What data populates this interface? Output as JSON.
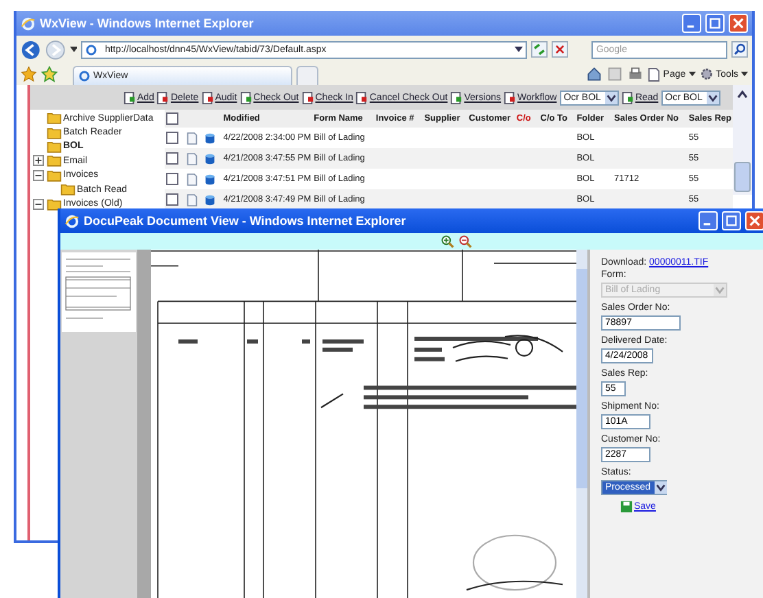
{
  "browser": {
    "title": "WxView - Windows Internet Explorer",
    "address": "http://localhost/dnn45/WxView/tabid/73/Default.aspx",
    "search": {
      "placeholder": "Google"
    },
    "tabs": [
      {
        "label": "WxView",
        "selected": true
      }
    ],
    "commands": [
      "Page",
      "Tools"
    ]
  },
  "toolbar": [
    {
      "kind": "link",
      "label": "Add"
    },
    {
      "kind": "link",
      "label": "Delete"
    },
    {
      "kind": "link",
      "label": "Audit"
    },
    {
      "kind": "link",
      "label": "Check Out"
    },
    {
      "kind": "link",
      "label": "Check In"
    },
    {
      "kind": "link",
      "label": "Cancel Check Out"
    },
    {
      "kind": "link",
      "label": "Versions"
    },
    {
      "kind": "link",
      "label": "Workflow"
    },
    {
      "kind": "select",
      "value": "Ocr BOL"
    },
    {
      "kind": "link",
      "label": "Read"
    },
    {
      "kind": "select",
      "value": "Ocr BOL"
    }
  ],
  "folder_tree": [
    {
      "label": "Archive SupplierData",
      "kind": "leaf",
      "selected": false
    },
    {
      "label": "Batch Reader",
      "kind": "leaf",
      "selected": false
    },
    {
      "label": "BOL",
      "kind": "leaf",
      "selected": true
    },
    {
      "label": "Email",
      "kind": "branch",
      "expanded": false,
      "selected": false
    },
    {
      "label": "Invoices",
      "kind": "branch",
      "expanded": true,
      "selected": false,
      "children": [
        {
          "label": "Batch Read",
          "kind": "leaf",
          "selected": false
        }
      ]
    },
    {
      "label": "Invoices (Old)",
      "kind": "branch",
      "expanded": true,
      "selected": false
    }
  ],
  "grid": {
    "select_all": {
      "checked": false
    },
    "columns": [
      {
        "label": "Modified",
        "color": "#1a1a1a"
      },
      {
        "label": "Form Name",
        "color": "#1a1a1a"
      },
      {
        "label": "Invoice #",
        "color": "#1a1a1a"
      },
      {
        "label": "Supplier",
        "color": "#1a1a1a"
      },
      {
        "label": "Customer",
        "color": "#1a1a1a"
      },
      {
        "label": "C/o",
        "color": "#cc1111"
      },
      {
        "label": "C/o To",
        "color": "#1a1a1a"
      },
      {
        "label": "Folder",
        "color": "#1a1a1a"
      },
      {
        "label": "Sales Order No",
        "color": "#1a1a1a"
      },
      {
        "label": "Sales Rep",
        "color": "#1a1a1a"
      }
    ],
    "rows": [
      {
        "checked": false,
        "modified": "4/22/2008 2:34:00 PM",
        "form_name": "Bill of Lading",
        "folder": "BOL",
        "sales_rep": "55"
      },
      {
        "checked": false,
        "modified": "4/21/2008 3:47:55 PM",
        "form_name": "Bill of Lading",
        "folder": "BOL",
        "sales_rep": "55"
      },
      {
        "checked": false,
        "modified": "4/21/2008 3:47:51 PM",
        "form_name": "Bill of Lading",
        "folder": "BOL",
        "sales_order_no": "71712",
        "sales_rep": "55"
      },
      {
        "checked": false,
        "modified": "4/21/2008 3:47:49 PM",
        "form_name": "Bill of Lading",
        "folder": "BOL",
        "sales_rep": "55"
      }
    ]
  },
  "viewer": {
    "title": "DocuPeak Document View - Windows Internet Explorer",
    "download": {
      "label": "Download:",
      "link": "00000011.TIF"
    },
    "fields": [
      {
        "label": "Form:",
        "kind": "select",
        "value": "Bill of Lading",
        "disabled": true
      },
      {
        "label": "Sales Order No:",
        "kind": "input",
        "value": "78897"
      },
      {
        "label": "Delivered Date:",
        "kind": "input",
        "value": "4/24/2008"
      },
      {
        "label": "Sales Rep:",
        "kind": "input",
        "value": "55"
      },
      {
        "label": "Shipment No:",
        "kind": "input",
        "value": "101A"
      },
      {
        "label": "Customer No:",
        "kind": "input",
        "value": "2287"
      },
      {
        "label": "Status:",
        "kind": "select",
        "value": "Processed",
        "disabled": false
      }
    ],
    "save": "Save"
  }
}
